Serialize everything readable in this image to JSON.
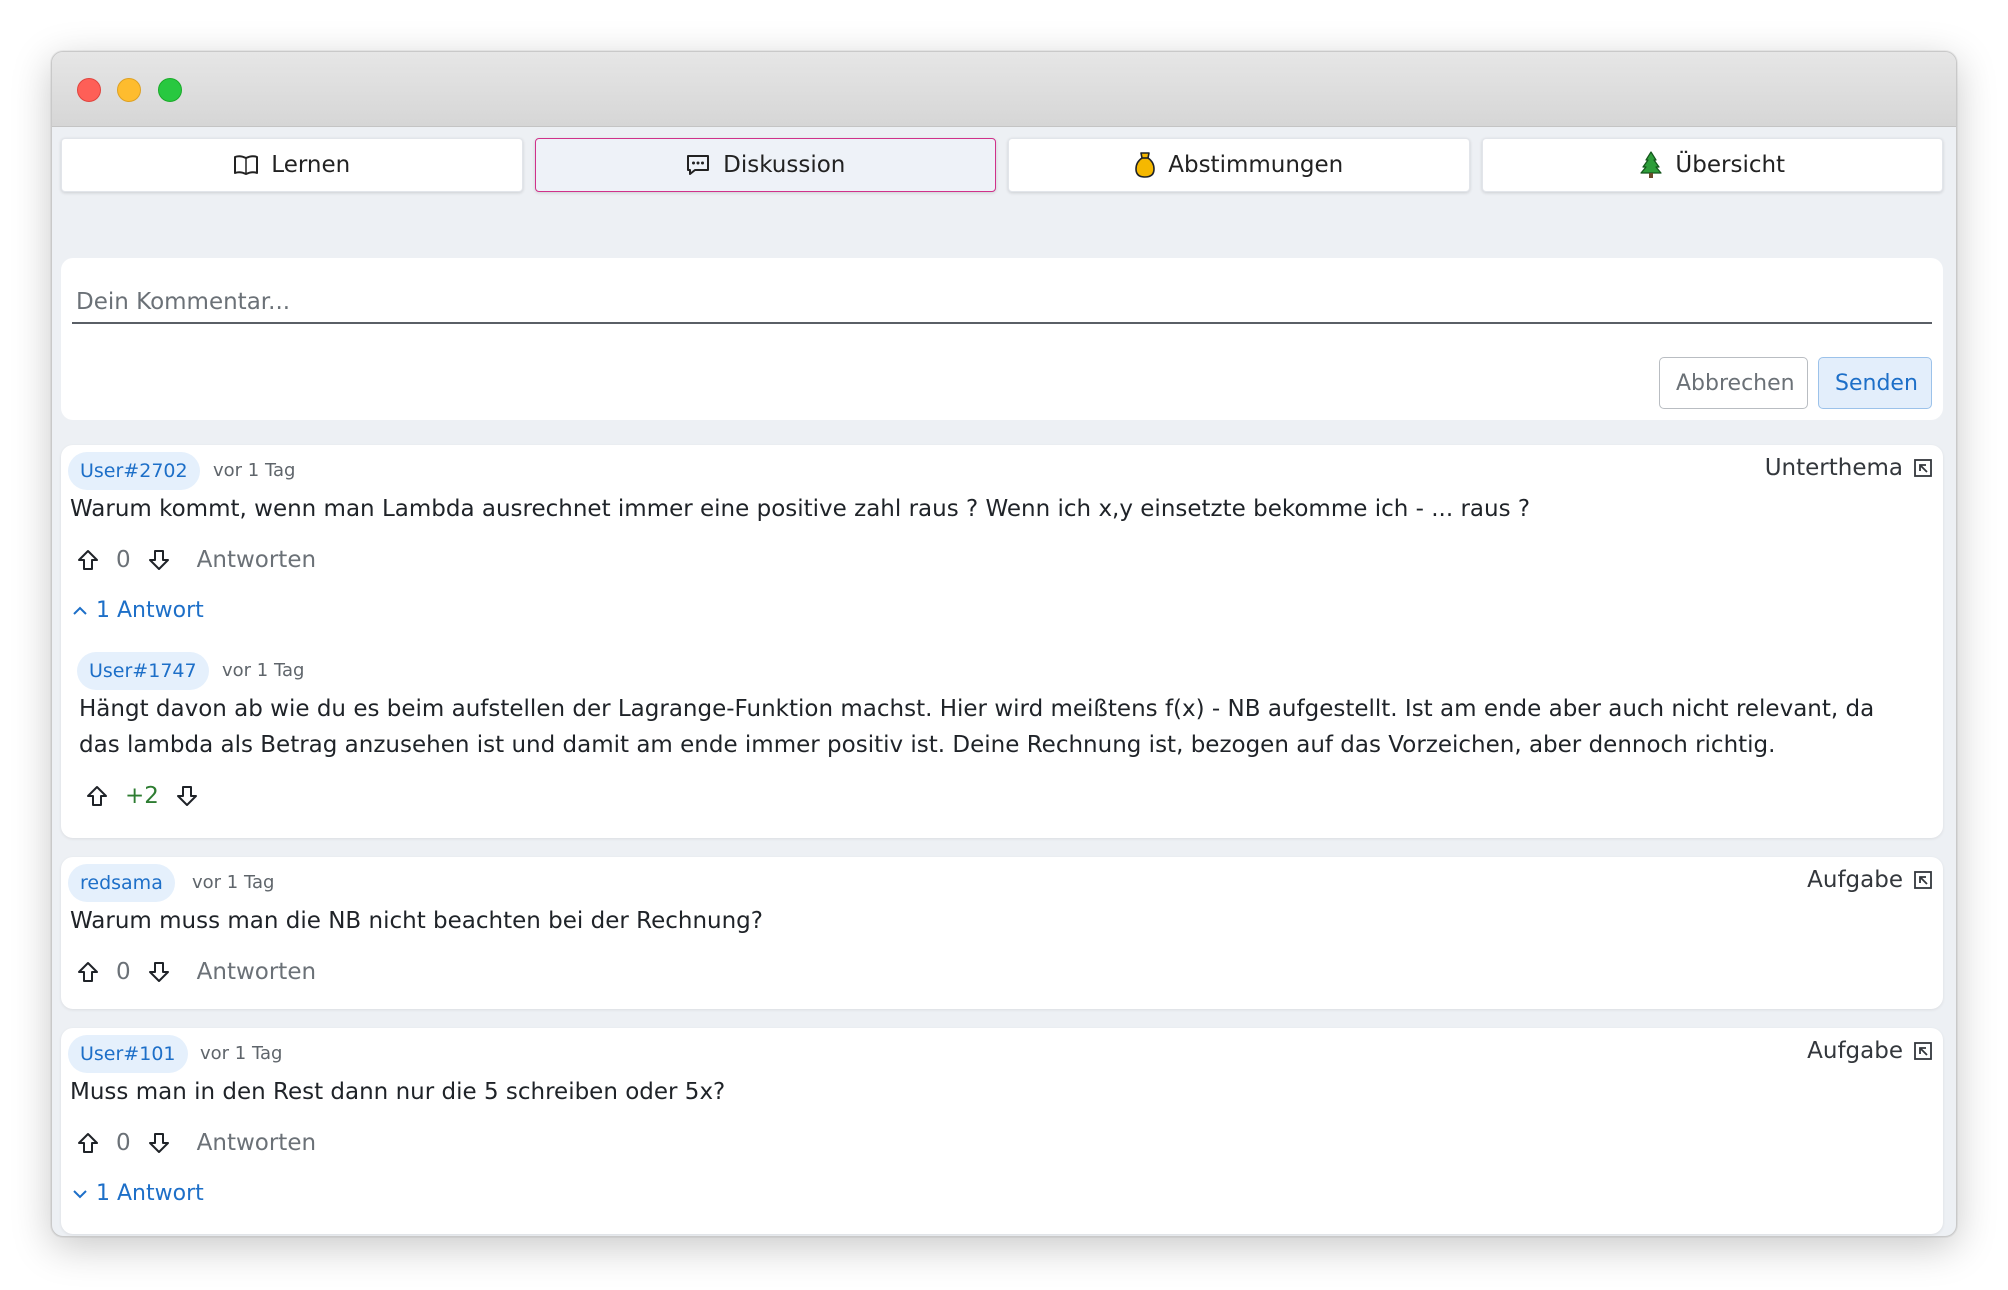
{
  "tabs": [
    {
      "label": "Lernen",
      "icon": "book-icon"
    },
    {
      "label": "Diskussion",
      "icon": "chat-icon"
    },
    {
      "label": "Abstimmungen",
      "icon": "vote-icon"
    },
    {
      "label": "Übersicht",
      "icon": "tree-icon"
    }
  ],
  "composer": {
    "placeholder": "Dein Kommentar...",
    "cancel_label": "Abbrechen",
    "send_label": "Senden"
  },
  "comments": [
    {
      "user": "User#2702",
      "time": "vor 1 Tag",
      "tag": "Unterthema",
      "text": "Warum kommt, wenn man Lambda ausrechnet immer eine positive zahl raus ? Wenn ich x,y einsetzte bekomme ich - ... raus ?",
      "votes": "0",
      "reply_label": "Antworten",
      "replies_toggle": "1 Antwort",
      "replies": [
        {
          "user": "User#1747",
          "time": "vor 1 Tag",
          "text": "Hängt davon ab wie du es beim aufstellen der Lagrange-Funktion machst. Hier wird meißtens f(x) - NB aufgestellt. Ist am ende aber auch nicht relevant, da das lambda als Betrag anzusehen ist und damit am ende immer positiv ist. Deine Rechnung ist, bezogen auf das Vorzeichen, aber dennoch richtig.",
          "votes": "+2"
        }
      ]
    },
    {
      "user": "redsama",
      "time": "vor 1 Tag",
      "tag": "Aufgabe",
      "text": "Warum muss man die NB nicht beachten bei der Rechnung?",
      "votes": "0",
      "reply_label": "Antworten"
    },
    {
      "user": "User#101",
      "time": "vor 1 Tag",
      "tag": "Aufgabe",
      "text": "Muss man in den Rest dann nur die 5 schreiben oder 5x?",
      "votes": "0",
      "reply_label": "Antworten",
      "replies_toggle": "1 Antwort"
    }
  ],
  "colors": {
    "accent": "#1d6fc8",
    "active_tab_border": "#d0318a",
    "positive": "#2e7d32"
  }
}
